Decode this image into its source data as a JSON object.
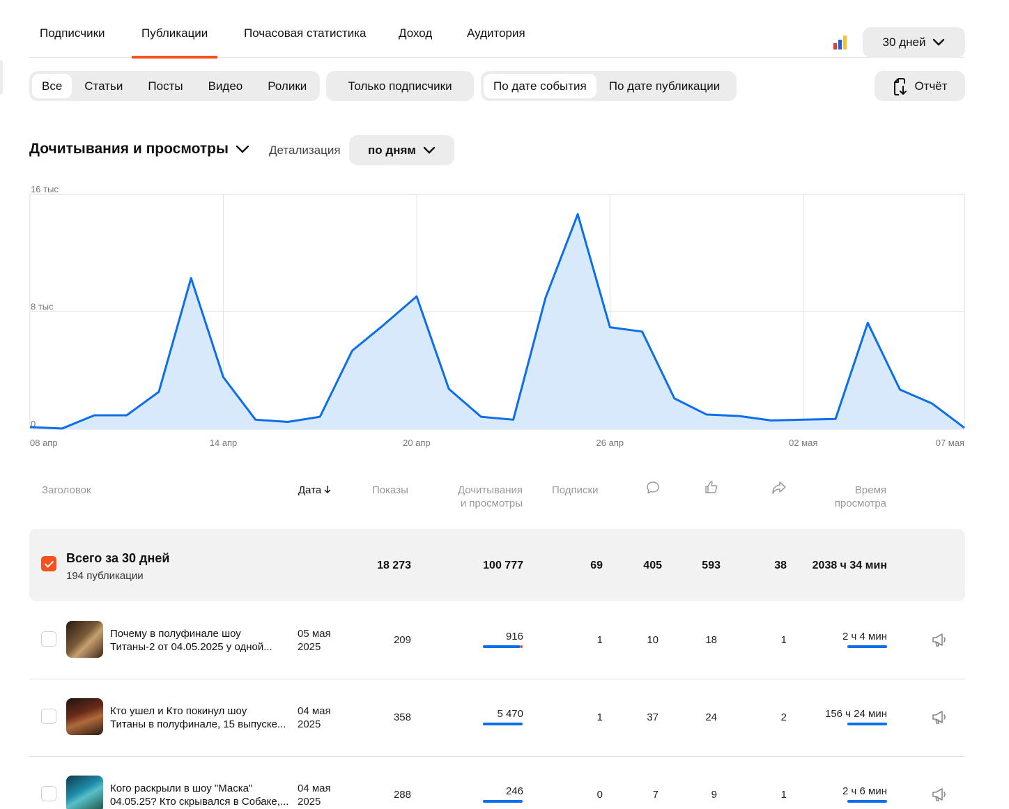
{
  "tabs": [
    "Подписчики",
    "Публикации",
    "Почасовая статистика",
    "Доход",
    "Аудитория"
  ],
  "active_tab": "Публикации",
  "period": "30 дней",
  "type_filters": [
    "Все",
    "Статьи",
    "Посты",
    "Видео",
    "Ролики"
  ],
  "subscribers_filter": "Только подписчики",
  "date_modes": [
    "По дате события",
    "По дате публикации"
  ],
  "report_label": "Отчёт",
  "metric_selector": "Дочитывания и просмотры",
  "detail_label": "Детализация",
  "detail_value": "по дням",
  "chart_data": {
    "type": "area",
    "x": [
      "08 апр",
      "09 апр",
      "10 апр",
      "11 апр",
      "12 апр",
      "13 апр",
      "14 апр",
      "15 апр",
      "16 апр",
      "17 апр",
      "18 апр",
      "19 апр",
      "20 апр",
      "21 апр",
      "22 апр",
      "23 апр",
      "24 апр",
      "25 апр",
      "26 апр",
      "27 апр",
      "28 апр",
      "29 апр",
      "30 апр",
      "01 мая",
      "02 мая",
      "03 мая",
      "04 мая",
      "05 мая",
      "06 мая",
      "07 мая"
    ],
    "series": [
      {
        "values": [
          150,
          50,
          950,
          950,
          2550,
          10300,
          3550,
          650,
          500,
          850,
          5350,
          7150,
          9050,
          2750,
          850,
          650,
          8950,
          14650,
          6950,
          6650,
          2100,
          1000,
          900,
          600,
          650,
          700,
          7250,
          2700,
          1750,
          100
        ]
      }
    ],
    "xticks": [
      "08 апр",
      "14 апр",
      "20 апр",
      "26 апр",
      "02 мая",
      "07 мая"
    ],
    "yticks": [
      "0",
      "8 тыс",
      "16 тыс"
    ],
    "ylim": [
      0,
      16000
    ],
    "grid": true,
    "color": "#0c6ee8"
  },
  "table": {
    "headers": {
      "title": "Заголовок",
      "date": "Дата",
      "impressions": [
        "Показы"
      ],
      "reads": [
        "Дочитывания",
        "и просмотры"
      ],
      "subs": [
        "Подписки"
      ],
      "time": [
        "Время",
        "просмотра"
      ]
    },
    "totals": {
      "title": "Всего за 30 дней",
      "subtitle": "194 публикации",
      "impressions": "18 273",
      "reads": "100 777",
      "subs": "69",
      "comments": "405",
      "likes": "593",
      "shares": "38",
      "time": "2038 ч 34 мин"
    },
    "rows": [
      {
        "title": [
          "Почему в полуфинале шоу",
          "Титаны-2 от 04.05.2025 у одной..."
        ],
        "date": [
          "05 мая",
          "2025"
        ],
        "impressions": "209",
        "reads": "916",
        "subs": "1",
        "comments": "10",
        "likes": "18",
        "shares": "1",
        "time": "2 ч 4 мин",
        "reads_fill": 0.95,
        "time_fill": 1.0
      },
      {
        "title": [
          "Кто ушел и Кто покинул шоу",
          "Титаны в полуфинале, 15 выпуске..."
        ],
        "date": [
          "04 мая",
          "2025"
        ],
        "impressions": "358",
        "reads": "5 470",
        "subs": "1",
        "comments": "37",
        "likes": "24",
        "shares": "2",
        "time": "156 ч 24 мин",
        "reads_fill": 1.0,
        "time_fill": 1.0
      },
      {
        "title": [
          "Кого раскрыли в шоу \"Маска\"",
          "04.05.25? Кто скрывался в Собаке,..."
        ],
        "date": [
          "04 мая",
          "2025"
        ],
        "impressions": "288",
        "reads": "246",
        "subs": "0",
        "comments": "7",
        "likes": "9",
        "shares": "1",
        "time": "2 ч 6 мин",
        "reads_fill": 1.0,
        "time_fill": 1.0
      }
    ]
  },
  "colors": {
    "accent": "#f4511e",
    "chart_line": "#0c6ee8",
    "chart_fill": "#d8e9fb",
    "chip_bg": "#ececec"
  }
}
